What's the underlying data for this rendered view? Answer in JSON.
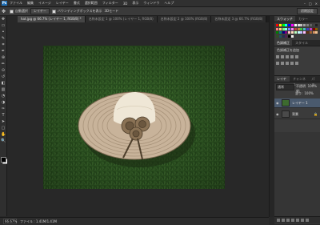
{
  "menubar": {
    "logo": "Ps",
    "items": [
      "ファイル",
      "編集",
      "イメージ",
      "レイヤー",
      "書式",
      "選択範囲",
      "フィルター",
      "3D",
      "表示",
      "ウィンドウ",
      "ヘルプ"
    ],
    "window_buttons": [
      "–",
      "□",
      "×"
    ]
  },
  "options_bar": {
    "tool_icon": "move-tool-icon",
    "auto_select_label": "自動選択",
    "layer_select": "レイヤー",
    "transform_label": "バウンディングボックスを表示",
    "mode_label": "3Dモード",
    "workspace": "初期設定"
  },
  "tabs": [
    {
      "label": "hat.jpg @ 66.7% (レイヤー 1, RGB/8) *",
      "active": true
    },
    {
      "label": "名称未設定 1 @ 100% (レイヤー 1, RGB/8)",
      "active": false
    },
    {
      "label": "名称未設定 2 @ 100% (RGB/8)",
      "active": false
    },
    {
      "label": "名称未設定 3 @ 66.7% (RGB/8)",
      "active": false
    }
  ],
  "tools": [
    "move-tool-icon",
    "marquee-tool-icon",
    "lasso-tool-icon",
    "quick-select-tool-icon",
    "crop-tool-icon",
    "eyedropper-tool-icon",
    "healing-brush-tool-icon",
    "brush-tool-icon",
    "clone-stamp-tool-icon",
    "history-brush-tool-icon",
    "eraser-tool-icon",
    "gradient-tool-icon",
    "blur-tool-icon",
    "dodge-tool-icon",
    "pen-tool-icon",
    "type-tool-icon",
    "path-select-tool-icon",
    "shape-tool-icon",
    "hand-tool-icon",
    "zoom-tool-icon"
  ],
  "tool_glyphs": [
    "✥",
    "▭",
    "ꔷ",
    "✎",
    "⌗",
    "✒",
    "⊕",
    "✏",
    "⊙",
    "↺",
    "◧",
    "▥",
    "◔",
    "◑",
    "✑",
    "T",
    "➤",
    "▢",
    "✋",
    "🔍"
  ],
  "status": {
    "zoom": "66.67%",
    "doc_info": "ファイル : 1.41M/1.41M"
  },
  "panels": {
    "swatch_tabs": [
      "スウォッチ",
      "カラー"
    ],
    "adjust_tabs": [
      "色調補正",
      "スタイル"
    ],
    "adjust_title": "色調補正を追加",
    "layer_tabs": [
      "レイヤー",
      "チャンネル",
      "パス"
    ],
    "blend_mode": "通常",
    "opacity_label": "不透明度:",
    "opacity": "100%",
    "fill_label": "塗り:",
    "fill": "100%",
    "layers": [
      {
        "name": "レイヤー 1",
        "active": true,
        "thumb_color": "#3d6b2f"
      },
      {
        "name": "背景",
        "active": false,
        "thumb_color": "#4a4a4a",
        "locked": true
      }
    ]
  },
  "swatch_colors": [
    "#ff0000",
    "#ffff00",
    "#00ff00",
    "#00ffff",
    "#0000ff",
    "#ff00ff",
    "#ffffff",
    "#e0e0e0",
    "#c0c0c0",
    "#a0a0a0",
    "#808080",
    "#606060",
    "#404040",
    "#202020",
    "#ff8080",
    "#ffd080",
    "#80ff80",
    "#80ffff",
    "#8080ff",
    "#ff80ff",
    "#c04040",
    "#c08040",
    "#40c040",
    "#40c0c0",
    "#4040c0",
    "#c040c0",
    "#800000",
    "#806000",
    "#008000",
    "#008080",
    "#000080",
    "#800080",
    "#ffc0c0",
    "#ffe0c0",
    "#c0ffc0",
    "#c0ffff",
    "#c0c0ff",
    "#ffc0ff",
    "#603010",
    "#a06030",
    "#d09060",
    "#f0c090",
    "#305020",
    "#205060",
    "#203050",
    "#502050",
    "#000000",
    "#f0f0f0"
  ],
  "photo": {
    "grass_color": "#2f5a23",
    "hat_brim_color": "#c8b39a",
    "hat_crown_color": "#efe7d6",
    "flower_color": "#8a7255"
  }
}
